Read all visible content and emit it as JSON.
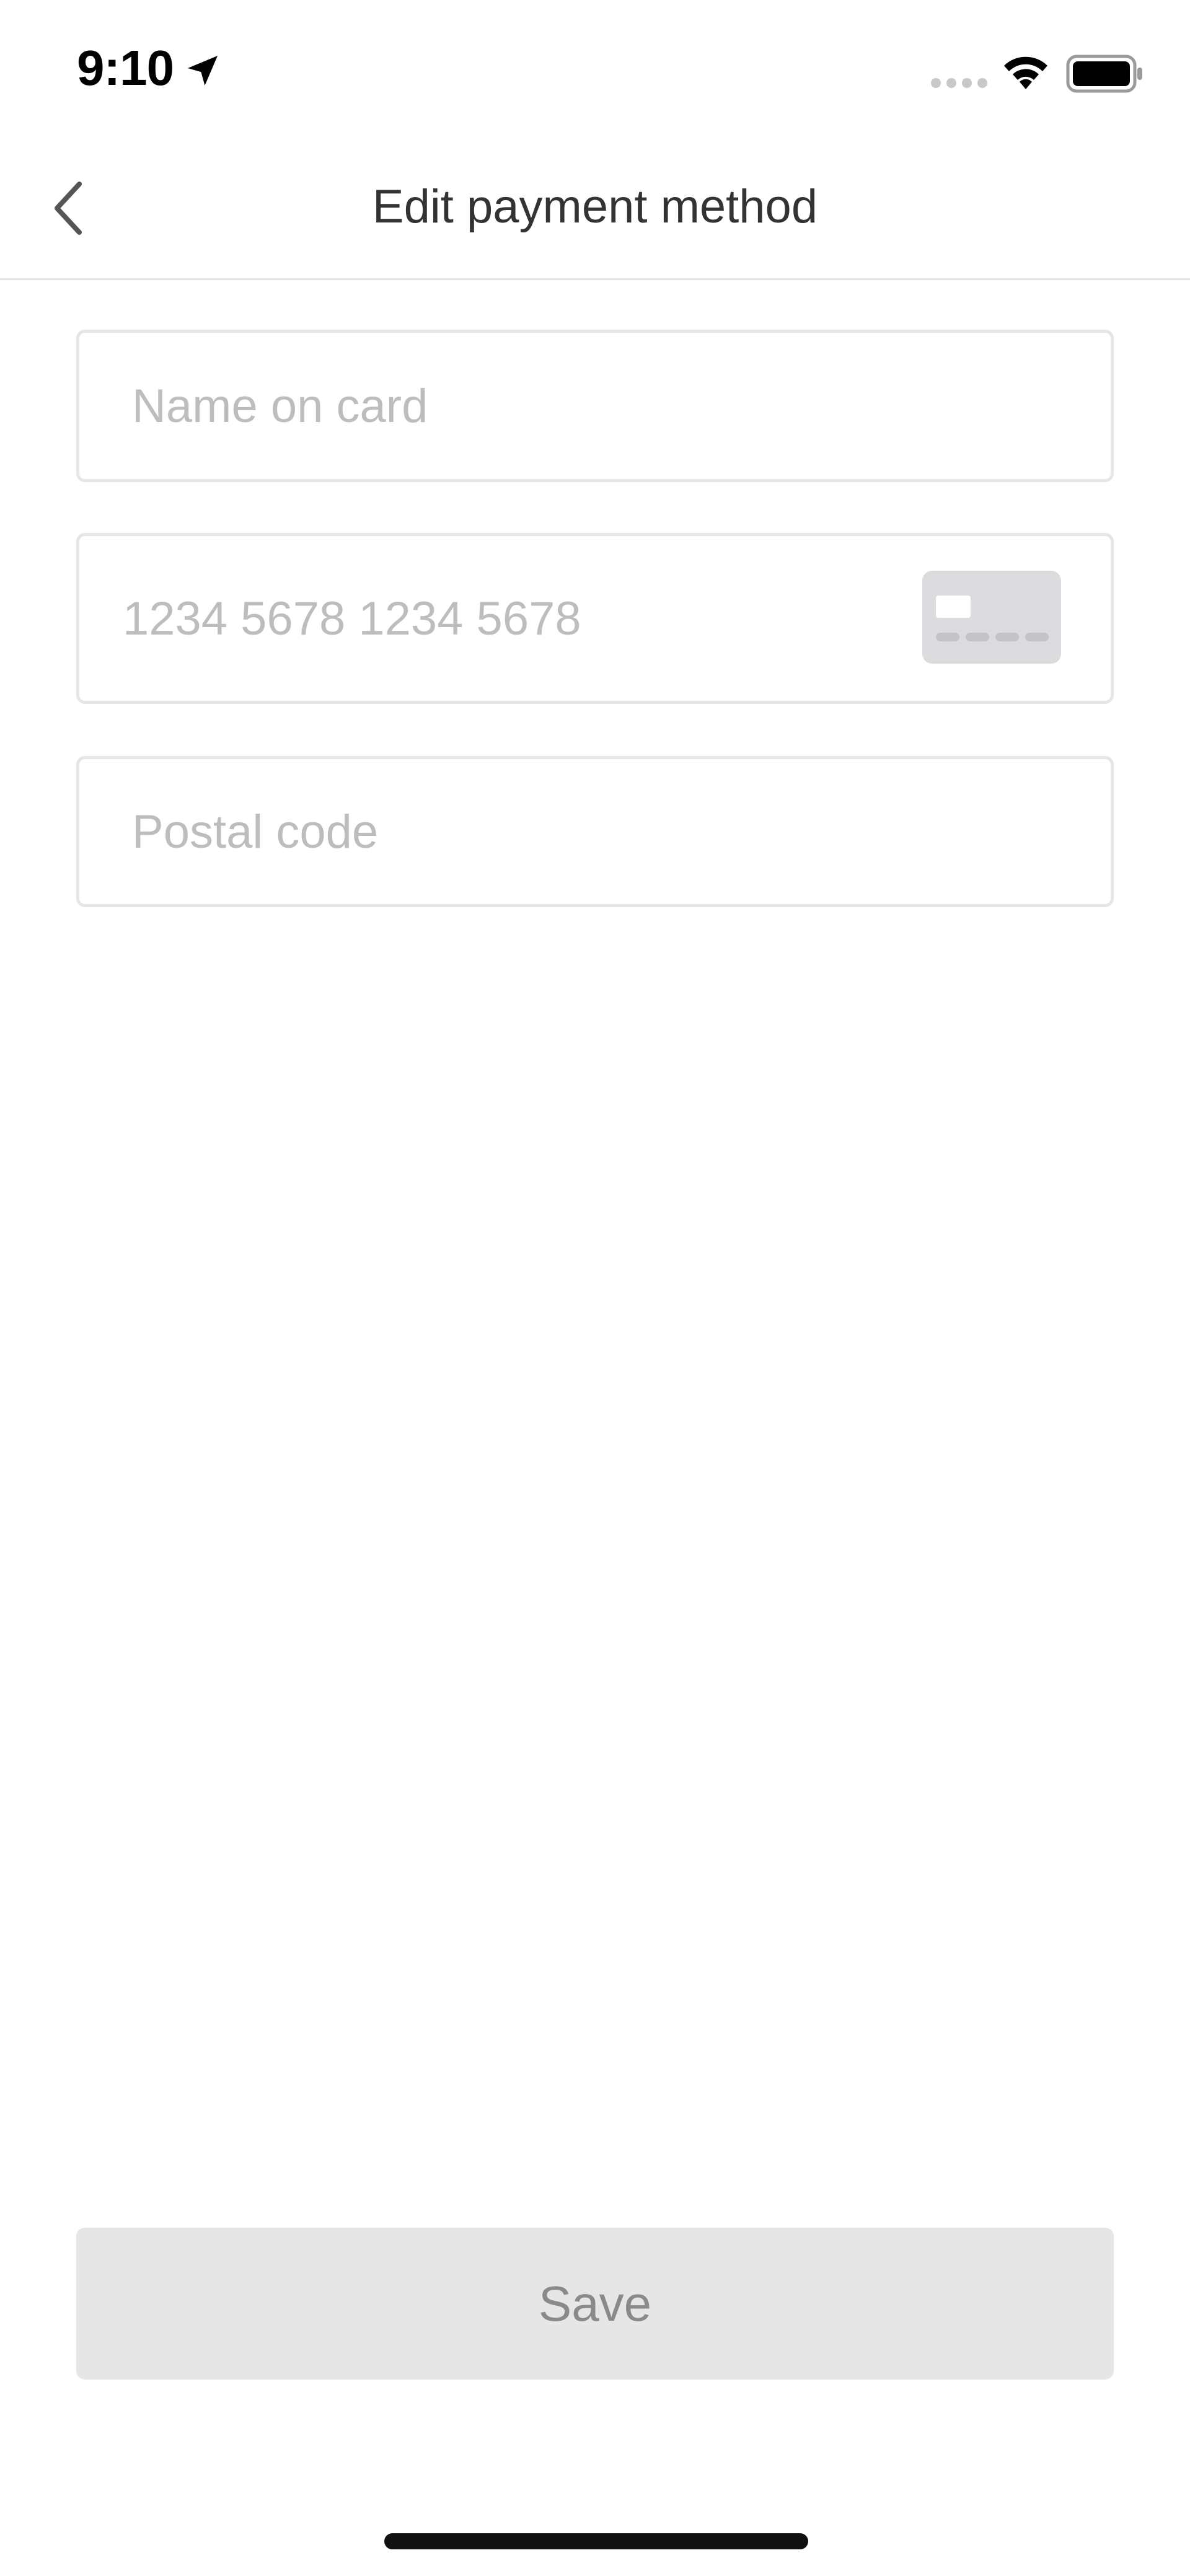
{
  "status_bar": {
    "time": "9:10",
    "location_icon": "location-arrow-icon",
    "signal_icon": "cellular-signal-icon",
    "wifi_icon": "wifi-icon",
    "battery_icon": "battery-full-icon"
  },
  "nav": {
    "title": "Edit payment method",
    "back_icon": "chevron-left-icon"
  },
  "form": {
    "name_placeholder": "Name on card",
    "name_value": "",
    "card_placeholder": "1234 5678 1234 5678",
    "card_value": "",
    "card_icon": "credit-card-icon",
    "postal_placeholder": "Postal code",
    "postal_value": ""
  },
  "actions": {
    "save_label": "Save"
  },
  "colors": {
    "field_border": "#e6e6e6",
    "placeholder": "#bdbdbd",
    "button_bg": "#e6e6e6",
    "button_text": "#8a8a8a",
    "title_text": "#333333"
  }
}
